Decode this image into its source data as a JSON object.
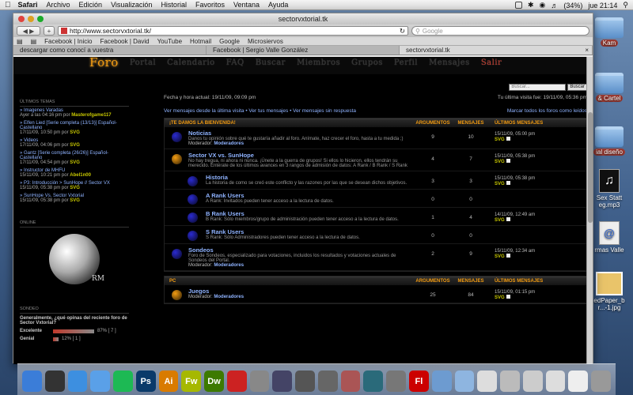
{
  "menubar": {
    "app": "Safari",
    "items": [
      "Archivo",
      "Edición",
      "Visualización",
      "Historial",
      "Favoritos",
      "Ventana",
      "Ayuda"
    ],
    "battery": "(34%)",
    "clock": "jue 21:14"
  },
  "desktop": {
    "icons": [
      {
        "label": "Kam"
      },
      {
        "label": "& Cartel"
      },
      {
        "label": "ial diseño"
      },
      {
        "label": "Sex Statt\neg.mp3"
      },
      {
        "label": "rmas Valle"
      },
      {
        "label": "edPaper_b\nr...-1.jpg"
      }
    ]
  },
  "window": {
    "title": "sectorvxtorial.tk"
  },
  "toolbar": {
    "url": "http://www.sectorvxtorial.tk/",
    "search_placeholder": "Google"
  },
  "bookmarks": [
    "Facebook | Inicio",
    "Facebook | David",
    "YouTube",
    "Hotmail",
    "Google",
    "Microsiervos"
  ],
  "tabs": [
    "descargar como conocí a vuestra",
    "Facebook | Sergio Valle González",
    "sectorvxtorial.tk"
  ],
  "site": {
    "nav": [
      "Foro",
      "Portal",
      "Calendario",
      "FAQ",
      "Buscar",
      "Miembros",
      "Grupos",
      "Perfil",
      "Mensajes",
      "Salir"
    ],
    "search": {
      "placeholder": "Buscar...",
      "button": "Buscar"
    },
    "date_now": "Fecha y hora actual: 19/11/09, 09:09 pm",
    "last_visit": "Tu última visita fue: 19/11/09, 05:36 pm",
    "links_left": "Ver mensajes desde la última visita • Ver tus mensajes • Ver mensajes sin respuesta",
    "links_right": "Marcar todos los foros como leídos",
    "sidebar": {
      "latest_title": "ÚLTIMOS TEMAS",
      "topics": [
        {
          "title": "» Imagenes Varadas",
          "meta": "Ayer a las 04:16 pm por",
          "author": "Masterofgame117"
        },
        {
          "title": "» Elfen Lied [Serie completa (13/13)] Español-Castellano",
          "meta": "17/11/09, 10:50 pm por",
          "author": "SVG"
        },
        {
          "title": "» Videos",
          "meta": "17/11/09, 04:06 pm por",
          "author": "SVG"
        },
        {
          "title": "» Gantz [Serie completa (26/26)] Español-Castellano",
          "meta": "17/11/09, 04:54 pm por",
          "author": "SVG"
        },
        {
          "title": "» Instructor de MHFU",
          "meta": "15/11/09, 10:21 pm por",
          "author": "Abel1n00"
        },
        {
          "title": "» P3: Introducción > SunHope // Sector VX",
          "meta": "15/11/09, 05:38 pm por",
          "author": "SVG"
        },
        {
          "title": "» SunHope Vs. Sector Vxtorial",
          "meta": "15/11/09, 05:38 pm por",
          "author": "SVG"
        }
      ],
      "online_title": "ONLINE",
      "online_logo": "RM",
      "poll_title": "SONDEO",
      "poll_question": "Generalmente, ¿qué opinas del reciente foro de Sector Vxtorial?",
      "poll": [
        {
          "label": "Excelente",
          "pct": "87% [ 7 ]",
          "value": 0.87
        },
        {
          "label": "Genial",
          "pct": "12% [ 1 ]",
          "value": 0.12
        }
      ]
    },
    "categories": [
      {
        "name": "¡TE DAMOS LA BIENVENIDA!",
        "col1": "ARGUMENTOS",
        "col2": "MENSAJES",
        "col3": "ÚLTIMOS MENSAJES",
        "forums": [
          {
            "name": "Noticias",
            "desc": "Danos tu opinión sobre qué te gustaría añadir al foro. Anímate, haz crecer el foro, hasta a tu medida ;)",
            "mods_label": "Moderador:",
            "mods": "Moderadores",
            "topics": "9",
            "posts": "10",
            "last_date": "15/11/09, 05:00 pm",
            "last_user": "SVG",
            "sub": false,
            "color": "#2a2ad0"
          },
          {
            "name": "Sector VX vs. SunHope",
            "desc": "No hay tregua, ni ahora ni nunca. ¡Únete a la guerra de grupos! Si ellos lo hicieron, ellos tendrán su merecido. Entérate de los últimos avances en 3 rangos de admisión de datos: A Rank / B Rank / S Rank",
            "mods_label": "",
            "mods": "",
            "topics": "4",
            "posts": "7",
            "last_date": "15/11/09, 05:38 pm",
            "last_user": "SVG",
            "sub": false,
            "color": "#f39c12"
          },
          {
            "name": "Historia",
            "desc": "La historia de como se creó este conflicto y las razones por las que se desean dichos objetivos.",
            "mods_label": "",
            "mods": "",
            "topics": "3",
            "posts": "3",
            "last_date": "15/11/09, 05:38 pm",
            "last_user": "SVG",
            "sub": true,
            "color": "#2a2ad0"
          },
          {
            "name": "A Rank Users",
            "desc": "A Rank: Invitados pueden tener acceso a la lectura de datos.",
            "mods_label": "",
            "mods": "",
            "topics": "0",
            "posts": "0",
            "last_date": "",
            "last_user": "",
            "sub": true,
            "color": "#2a2ad0"
          },
          {
            "name": "B Rank Users",
            "desc": "B Rank: Sólo miembros/grupo de administración pueden tener acceso a la lectura de datos.",
            "mods_label": "",
            "mods": "",
            "topics": "1",
            "posts": "4",
            "last_date": "14/11/09, 12:49 am",
            "last_user": "SVG",
            "sub": true,
            "color": "#2a2ad0"
          },
          {
            "name": "S Rank Users",
            "desc": "S Rank: Sólo Administradores pueden tener acceso a la lectura de datos.",
            "mods_label": "",
            "mods": "",
            "topics": "0",
            "posts": "0",
            "last_date": "",
            "last_user": "",
            "sub": true,
            "color": "#2a2ad0"
          },
          {
            "name": "Sondeos",
            "desc": "Foro de Sondeos, especializado para votaciones, incluidos los resultados y votaciones actuales de Sondeos del Portal.",
            "mods_label": "Moderador:",
            "mods": "Moderadores",
            "topics": "2",
            "posts": "9",
            "last_date": "15/11/09, 12:34 am",
            "last_user": "SVG",
            "sub": false,
            "color": "#2a2ad0"
          }
        ]
      },
      {
        "name": "PC",
        "col1": "ARGUMENTOS",
        "col2": "MENSAJES",
        "col3": "ÚLTIMOS MENSAJES",
        "forums": [
          {
            "name": "Juegos",
            "desc": "",
            "mods_label": "Moderador:",
            "mods": "Moderadores",
            "topics": "25",
            "posts": "84",
            "last_date": "15/11/09, 01:15 pm",
            "last_user": "SVG",
            "sub": false,
            "color": "#f39c12"
          }
        ]
      }
    ]
  },
  "dock": [
    {
      "label": "Finder",
      "color": "#3b7dd8"
    },
    {
      "label": "Dashboard",
      "color": "#333"
    },
    {
      "label": "Safari",
      "color": "#3d8fe0"
    },
    {
      "label": "iTunes",
      "color": "#5aa0e8"
    },
    {
      "label": "Spotify",
      "color": "#1db954"
    },
    {
      "label": "Ps",
      "color": "#0a3a6a"
    },
    {
      "label": "Ai",
      "color": "#d97b00"
    },
    {
      "label": "Fw",
      "color": "#a6b800"
    },
    {
      "label": "Dw",
      "color": "#3d7a00"
    },
    {
      "label": "iCal",
      "color": "#c22"
    },
    {
      "label": "Preview",
      "color": "#888"
    },
    {
      "label": "iPhoto",
      "color": "#446"
    },
    {
      "label": "iMovie",
      "color": "#555"
    },
    {
      "label": "Star",
      "color": "#666"
    },
    {
      "label": "GarageBand",
      "color": "#a55"
    },
    {
      "label": "Time Machine",
      "color": "#2a6a7a"
    },
    {
      "label": "Preferences",
      "color": "#777"
    },
    {
      "label": "Fl",
      "color": "#c00"
    },
    {
      "label": "Apps",
      "color": "#6d9bd0"
    },
    {
      "label": "Docs",
      "color": "#8eb5e0"
    },
    {
      "label": "Downloads",
      "color": "#ddd"
    },
    {
      "label": "Stack",
      "color": "#bbb"
    },
    {
      "label": "Stack2",
      "color": "#ccc"
    },
    {
      "label": "Stack3",
      "color": "#ddd"
    },
    {
      "label": "Stack4",
      "color": "#eee"
    },
    {
      "label": "Trash",
      "color": "#999"
    }
  ]
}
